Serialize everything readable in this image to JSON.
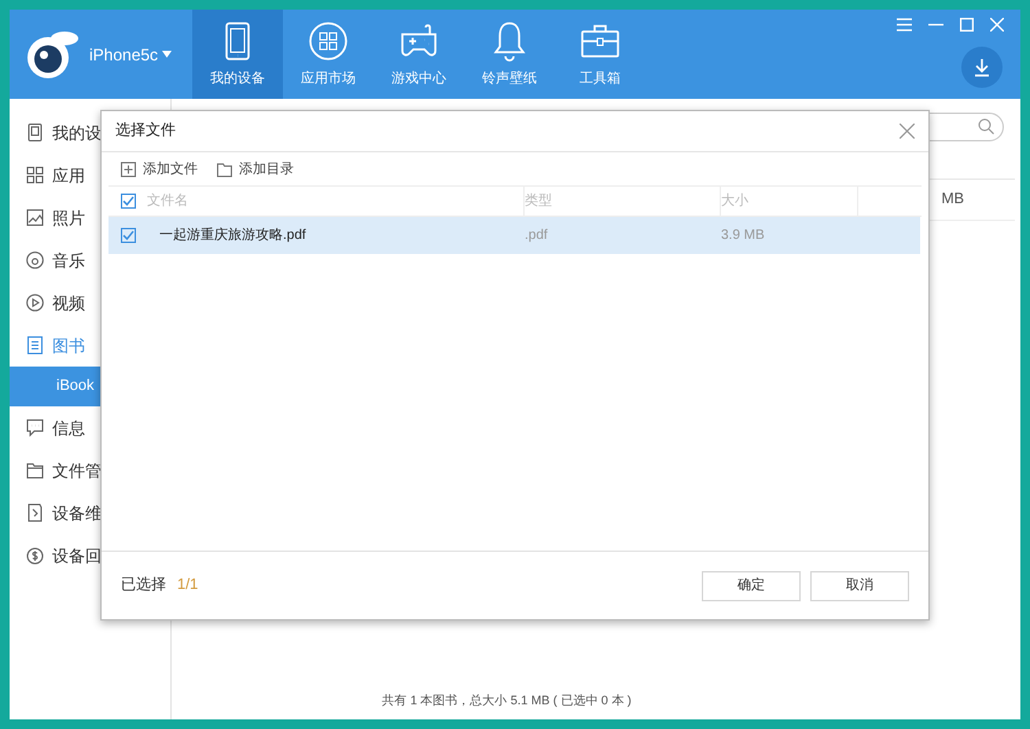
{
  "header": {
    "device": "iPhone5c",
    "nav_tabs": [
      {
        "label": "我的设备",
        "selected": true
      },
      {
        "label": "应用市场",
        "selected": false
      },
      {
        "label": "游戏中心",
        "selected": false
      },
      {
        "label": "铃声壁纸",
        "selected": false
      },
      {
        "label": "工具箱",
        "selected": false
      }
    ]
  },
  "sidebar": {
    "items": [
      {
        "label": "我的设",
        "expanded": false
      },
      {
        "label": "应用",
        "expanded": false
      },
      {
        "label": "照片",
        "expanded": false
      },
      {
        "label": "音乐",
        "expanded": false
      },
      {
        "label": "视频",
        "expanded": false
      },
      {
        "label": "图书",
        "expanded": true,
        "children": [
          {
            "label": "iBook",
            "selected": true
          }
        ]
      },
      {
        "label": "信息",
        "expanded": false
      },
      {
        "label": "文件管",
        "expanded": false
      },
      {
        "label": "设备维",
        "expanded": false
      },
      {
        "label": "设备回",
        "expanded": false
      }
    ]
  },
  "content": {
    "table_cell": "MB",
    "status_bar": "共有 1 本图书，总大小 5.1 MB ( 已选中 0 本 )"
  },
  "dialog": {
    "title": "选择文件",
    "toolbar": [
      "添加文件",
      "添加目录"
    ],
    "all_checked": true,
    "columns": [
      "文件名",
      "类型",
      "大小"
    ],
    "rows": [
      {
        "name": "一起游重庆旅游攻略.pdf",
        "type": ".pdf",
        "size": "3.9 MB",
        "checked": true,
        "selected": true
      }
    ],
    "selection_label": "已选择",
    "selection_count": "1/1",
    "buttons": [
      "确定",
      "取消"
    ]
  }
}
